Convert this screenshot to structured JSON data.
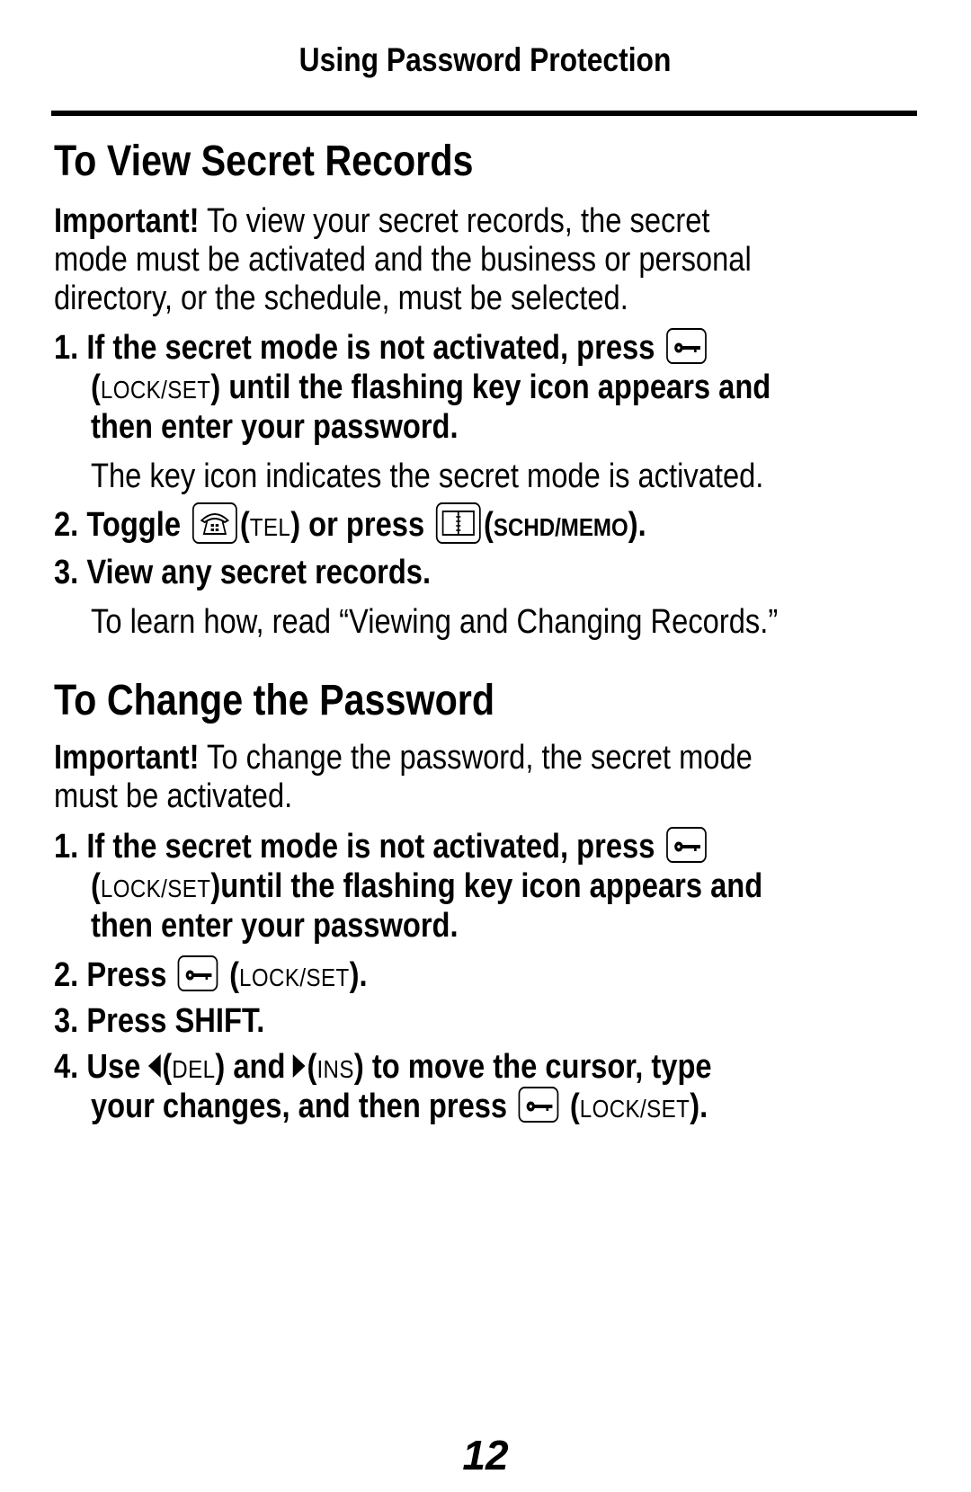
{
  "header": {
    "title": "Using Password Protection"
  },
  "section1": {
    "title": "To View Secret Records",
    "important_label": "Important!",
    "important_lines": [
      " To view your secret records, the secret",
      "mode must be activated and the business or personal",
      "directory, or the schedule, must be selected."
    ],
    "step1": {
      "number": "1.",
      "line1": "If the secret mode is not activated, press",
      "key_label": "LOCK/SET",
      "line2_rest": " until the flashing key icon appears and",
      "line3": "then enter your password.",
      "note": "The key icon indicates the secret mode is activated."
    },
    "step2": {
      "number": "2.",
      "toggle": "Toggle",
      "tel_label": "TEL",
      "or_press": " or press",
      "schd_label": "SCHD/MEMO",
      "end": "."
    },
    "step3": {
      "number": "3.",
      "text": "View any secret records.",
      "note": "To learn how, read “Viewing and Changing Records.”"
    }
  },
  "section2": {
    "title": "To Change the Password",
    "important_label": "Important!",
    "important_lines": [
      " To change the password, the secret mode",
      "must be activated."
    ],
    "step1": {
      "number": "1.",
      "line1": "If the secret mode is not activated, press",
      "key_label": "LOCK/SET",
      "line2_rest": "until the flashing key icon appears and",
      "line3": "then enter your password."
    },
    "step2": {
      "number": "2.",
      "text": "Press",
      "key_label": "LOCK/SET",
      "end": "."
    },
    "step3": {
      "number": "3.",
      "text": "Press SHIFT."
    },
    "step4": {
      "number": "4.",
      "use": "Use",
      "del_label": "DEL",
      "and": " and",
      "ins_label": "INS",
      "line1_rest": " to move the cursor, type",
      "line2": "your changes, and then press",
      "key_label": "LOCK/SET",
      "end": "."
    }
  },
  "footer": {
    "page_number": "12"
  }
}
